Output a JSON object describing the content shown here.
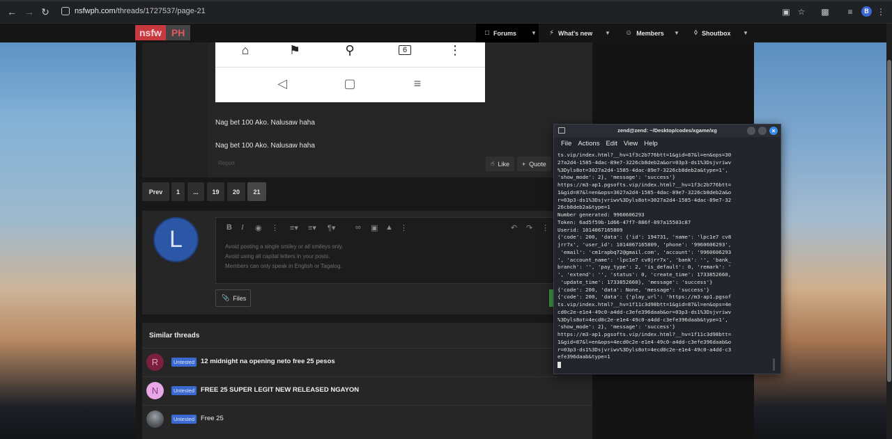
{
  "browser": {
    "url_host": "nsfwph.com",
    "url_path": "/threads/1727537/page-21",
    "profile_initial": "B"
  },
  "site": {
    "logo_left": "nsfw",
    "logo_right": "PH",
    "nav": [
      {
        "label": "Forums",
        "icon": "chat-icon"
      },
      {
        "label": "What's new",
        "icon": "bolt-icon"
      },
      {
        "label": "Members",
        "icon": "user-icon"
      },
      {
        "label": "Shoutbox",
        "icon": "tag-icon"
      }
    ]
  },
  "post": {
    "text_1": "Nag bet 100 Ako. Nalusaw haha",
    "text_2": "Nag bet 100 Ako. Nalusaw haha",
    "report_label": "Report",
    "like_label": "Like",
    "quote_label": "Quote",
    "phone_tab_count": "6"
  },
  "pagination": {
    "prev_label": "Prev",
    "pages": [
      "1",
      "...",
      "19",
      "20",
      "21"
    ],
    "current": "21"
  },
  "reply": {
    "avatar_letter": "L",
    "hints": [
      "Avoid posting a single smiley or all smileys only.",
      "Avoid using all capital letters in your posts.",
      "Members can only speak in English or Tagalog."
    ],
    "files_label": "Files"
  },
  "similar": {
    "title": "Similar threads",
    "threads": [
      {
        "avatar": "R",
        "badge": "Untested",
        "title": "12 midnight na opening neto free 25 pesos",
        "avatar_bg": "#7a1f3d",
        "avatar_fg": "#e8a0b8"
      },
      {
        "avatar": "N",
        "badge": "Untested",
        "title": "FREE 25 SUPER LEGIT NEW RELEASED NGAYON",
        "avatar_bg": "#e8a8e8",
        "avatar_fg": "#8a3a8a"
      },
      {
        "avatar": "",
        "badge": "Untested",
        "title": "Free 25",
        "avatar_bg": "#6a6e74",
        "avatar_fg": "#ffffff"
      }
    ]
  },
  "terminal": {
    "title": "zend@zend: ~/Desktop/codes/xgame/xg",
    "menu": [
      "File",
      "Actions",
      "Edit",
      "View",
      "Help"
    ],
    "lines": [
      "ts.vip/index.html?__hv=1f3c2b776btt=1&gid=87&l=en&ops=30",
      "27a2d4-1585-4dac-89e7-3226cb8deb2a&or=03p3-ds1%3Dsjvriwv",
      "%3Dyls8ot=3027a2d4-1585-4dac-89e7-3226cb8deb2a&type=1',",
      "'show_mode': 2}, 'message': 'success'}",
      "https://m3-ap1.pgsofts.vip/index.html?__hv=1f3c2b776btt=",
      "1&gid=87&l=en&ops=3027a2d4-1585-4dac-89e7-3226cb8deb2a&o",
      "r=03p3-ds1%3Dsjvriwv%3Dyls8ot=3027a2d4-1585-4dac-89e7-32",
      "26cb8deb2a&type=1",
      "Number generated: 9960606293",
      "Token: 6ad5f59b-1d66-47f7-886f-897a15503c87",
      "Userid: 1014067165809",
      "{'code': 200, 'data': {'id': 194731, 'name': 'lpc1e7 cv8",
      "jrr7x', 'user_id': 1014067165809, 'phone': '9960606293',",
      " 'email': 'cm1rapbq72@gmail.com', 'account': '9960606293",
      "', 'account_name': 'lpc1e7 cv8jrr7x', 'bank': '', 'bank_",
      "branch': '', 'pay_type': 2, 'is_default': 0, 'remark': '",
      "', 'extend': '', 'status': 0, 'create_time': 1733852660,",
      " 'update_time': 1733852660}, 'message': 'success'}",
      "{'code': 200, 'data': None, 'message': 'success'}",
      "{'code': 200, 'data': {'play_url': 'https://m3-ap1.pgsof",
      "ts.vip/index.html?__hv=1f11c3d98btt=1&gid=87&l=en&ops=4e",
      "cd0c2e-e1e4-49c0-a4dd-c3efe396daab&or=03p3-ds1%3Dsjvriwv",
      "%3Dyls8ot=4ecd0c2e-e1e4-49c0-a4dd-c3efe396daab&type=1',",
      "'show_mode': 2}, 'message': 'success'}",
      "https://m3-ap1.pgsofts.vip/index.html?__hv=1f11c3d98btt=",
      "1&gid=87&l=en&ops=4ecd0c2e-e1e4-49c0-a4dd-c3efe396daab&o",
      "r=03p3-ds1%3Dsjvriwv%3Dyls8ot=4ecd0c2e-e1e4-49c0-a4dd-c3",
      "efe396daab&type=1"
    ]
  }
}
